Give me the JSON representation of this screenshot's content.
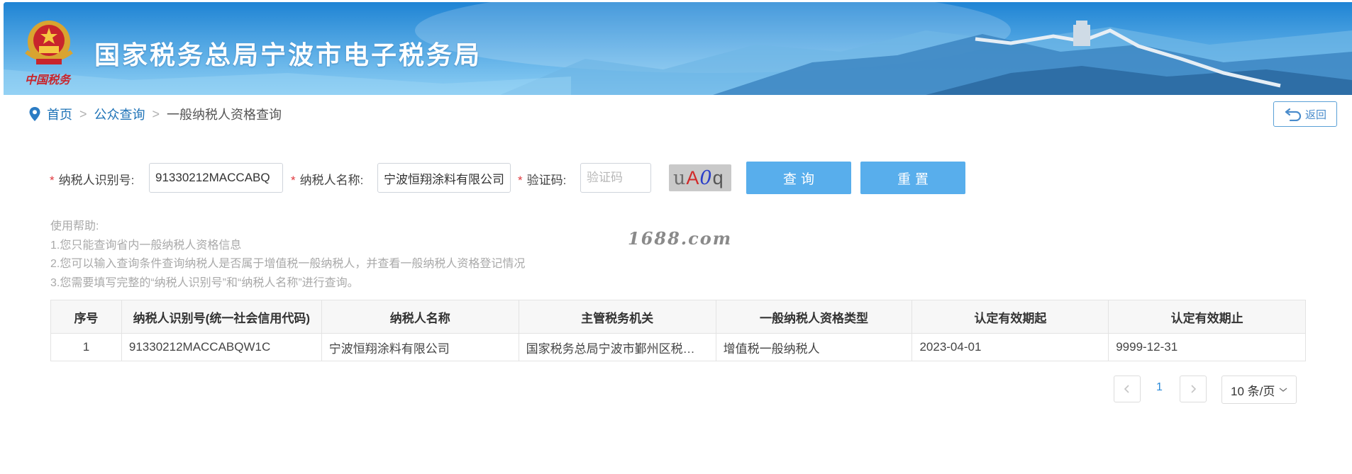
{
  "header": {
    "site_title": "国家税务总局宁波市电子税务局",
    "emblem_caption": "中国税务"
  },
  "breadcrumb": {
    "home": "首页",
    "separator": ">",
    "public_query": "公众查询",
    "current": "一般纳税人资格查询"
  },
  "back_button": {
    "label": "返回"
  },
  "form": {
    "taxpayer_id": {
      "label": "纳税人识别号:",
      "value": "91330212MACCABQ"
    },
    "taxpayer_name": {
      "label": "纳税人名称:",
      "value": "宁波恒翔涂料有限公司"
    },
    "captcha": {
      "label": "验证码:",
      "placeholder": "验证码",
      "image_chars": [
        "u",
        "A",
        "0",
        "q"
      ]
    },
    "required_mark": "*",
    "search_label": "查询",
    "reset_label": "重置"
  },
  "help": {
    "title": "使用帮助:",
    "lines": [
      "1.您只能查询省内一般纳税人资格信息",
      "2.您可以输入查询条件查询纳税人是否属于增值税一般纳税人，并查看一般纳税人资格登记情况",
      "3.您需要填写完整的“纳税人识别号”和“纳税人名称”进行查询。"
    ]
  },
  "watermark": "1688.com",
  "table": {
    "headers": [
      "序号",
      "纳税人识别号(统一社会信用代码)",
      "纳税人名称",
      "主管税务机关",
      "一般纳税人资格类型",
      "认定有效期起",
      "认定有效期止"
    ],
    "rows": [
      [
        "1",
        "91330212MACCABQW1C",
        "宁波恒翔涂料有限公司",
        "国家税务总局宁波市鄞州区税…",
        "增值税一般纳税人",
        "2023-04-01",
        "9999-12-31"
      ]
    ]
  },
  "pagination": {
    "current_page": "1",
    "page_size": "10 条/页"
  },
  "colors": {
    "primary_button": "#58aeec",
    "link": "#1f73b7",
    "required": "#e0393e"
  }
}
